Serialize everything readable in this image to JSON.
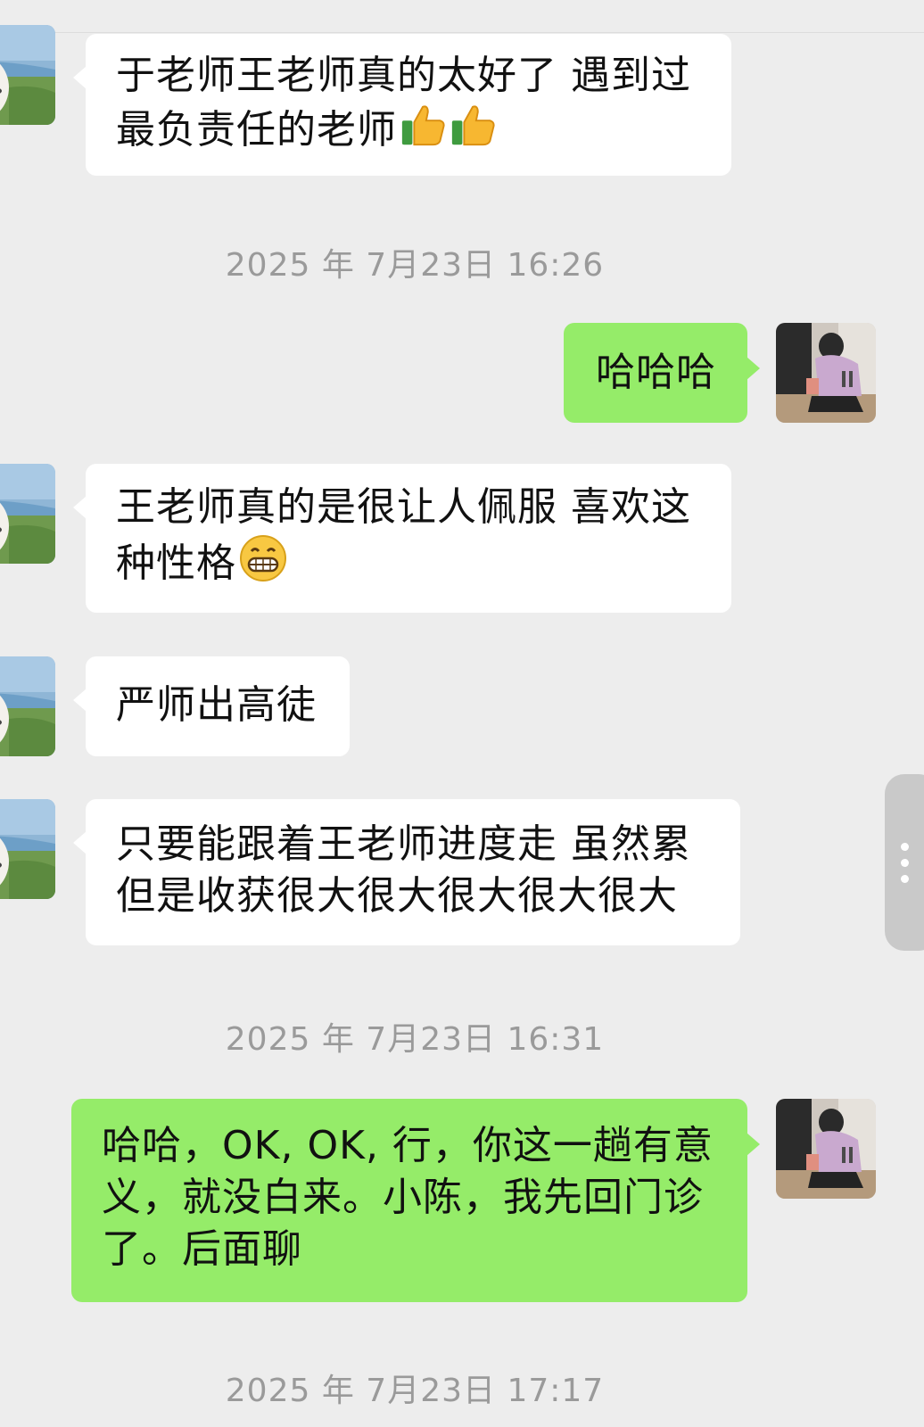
{
  "chat": {
    "messages": [
      {
        "sender": "other",
        "text": "于老师王老师真的太好了 遇到过最负责任的老师",
        "emoji": [
          "thumbs-up-emoji",
          "thumbs-up-emoji"
        ]
      },
      {
        "type": "timestamp",
        "text": "2025 年 7月23日 16:26"
      },
      {
        "sender": "self",
        "text": "哈哈哈"
      },
      {
        "sender": "other",
        "text": "王老师真的是很让人佩服 喜欢这种性格",
        "emoji": [
          "grinning-face-emoji"
        ]
      },
      {
        "sender": "other",
        "text": "严师出高徒"
      },
      {
        "sender": "other",
        "text": "只要能跟着王老师进度走 虽然累但是收获很大很大很大很大很大"
      },
      {
        "type": "timestamp",
        "text": "2025 年 7月23日 16:31"
      },
      {
        "sender": "self",
        "text": "哈哈，OK, OK, 行，你这一趟有意义，就没白来。小陈，我先回门诊了。后面聊"
      },
      {
        "type": "timestamp",
        "text": "2025 年 7月23日 17:17"
      }
    ]
  },
  "icons": {
    "other_avatar": "white-dog-lakeside-avatar",
    "self_avatar": "crouching-person-avatar",
    "scroll_handle": "vertical-dots-icon"
  },
  "colors": {
    "background": "#ededed",
    "incoming_bubble": "#ffffff",
    "outgoing_bubble": "#95ec69",
    "timestamp_text": "#9a9a9a"
  }
}
